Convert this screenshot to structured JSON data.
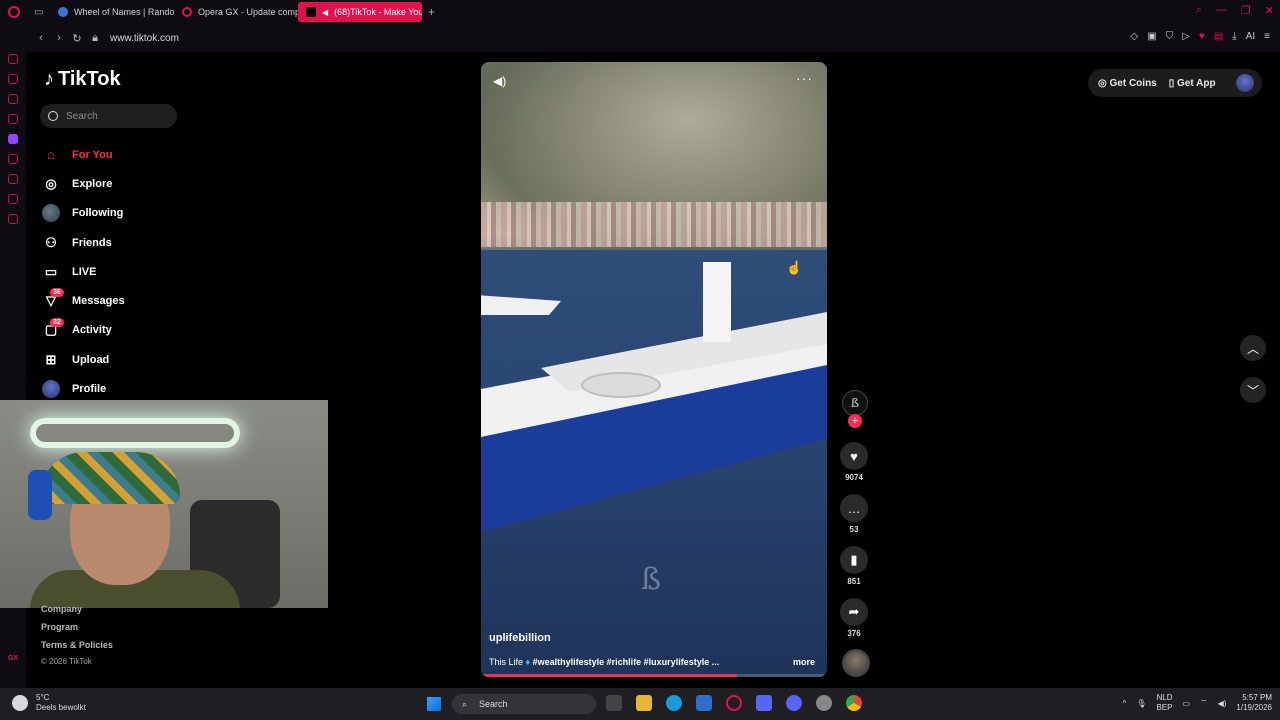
{
  "browser": {
    "tabs": [
      {
        "title": "Wheel of Names | Random",
        "active": false,
        "icon": "wheel-favicon",
        "color": "#3a76d6"
      },
      {
        "title": "Opera GX - Update comp",
        "active": false,
        "icon": "opera-favicon",
        "color": "#e0114b"
      },
      {
        "title": "(68)TikTok - Make You",
        "active": true,
        "icon": "tiktok-favicon",
        "color": "#000000"
      }
    ],
    "url": "www.tiktok.com"
  },
  "tiktok": {
    "logo": "TikTok",
    "search_placeholder": "Search",
    "nav": [
      {
        "label": "For You",
        "icon": "home-icon",
        "active": true
      },
      {
        "label": "Explore",
        "icon": "compass-icon"
      },
      {
        "label": "Following",
        "icon": "following-avatar"
      },
      {
        "label": "Friends",
        "icon": "friends-icon"
      },
      {
        "label": "LIVE",
        "icon": "live-icon"
      },
      {
        "label": "Messages",
        "icon": "messages-icon",
        "badge": "36"
      },
      {
        "label": "Activity",
        "icon": "activity-icon",
        "badge": "32"
      },
      {
        "label": "Upload",
        "icon": "upload-icon"
      },
      {
        "label": "Profile",
        "icon": "profile-avatar"
      }
    ],
    "footer": {
      "links": [
        "Company",
        "Program",
        "Terms & Policies"
      ],
      "copyright": "© 2026 TikTok"
    },
    "top_right": {
      "get_coins": "Get Coins",
      "get_app": "Get App"
    },
    "video": {
      "username": "uplifebillion",
      "caption_prefix": "This Life",
      "caption_tags": "#wealthylifestyle #richlife #luxurylifestyle ...",
      "more": "more",
      "progress": 0.74,
      "watermark": "ß"
    },
    "actions": {
      "likes": "9074",
      "comments": "53",
      "saves": "851",
      "shares": "376",
      "accent": "#fe2c55"
    }
  },
  "taskbar": {
    "weather_temp": "5°C",
    "weather_desc": "Deels bewolkt",
    "search": "Search",
    "lang_top": "NLD",
    "lang_bottom": "BEP",
    "time": "5:57 PM",
    "date": "1/19/2026"
  }
}
